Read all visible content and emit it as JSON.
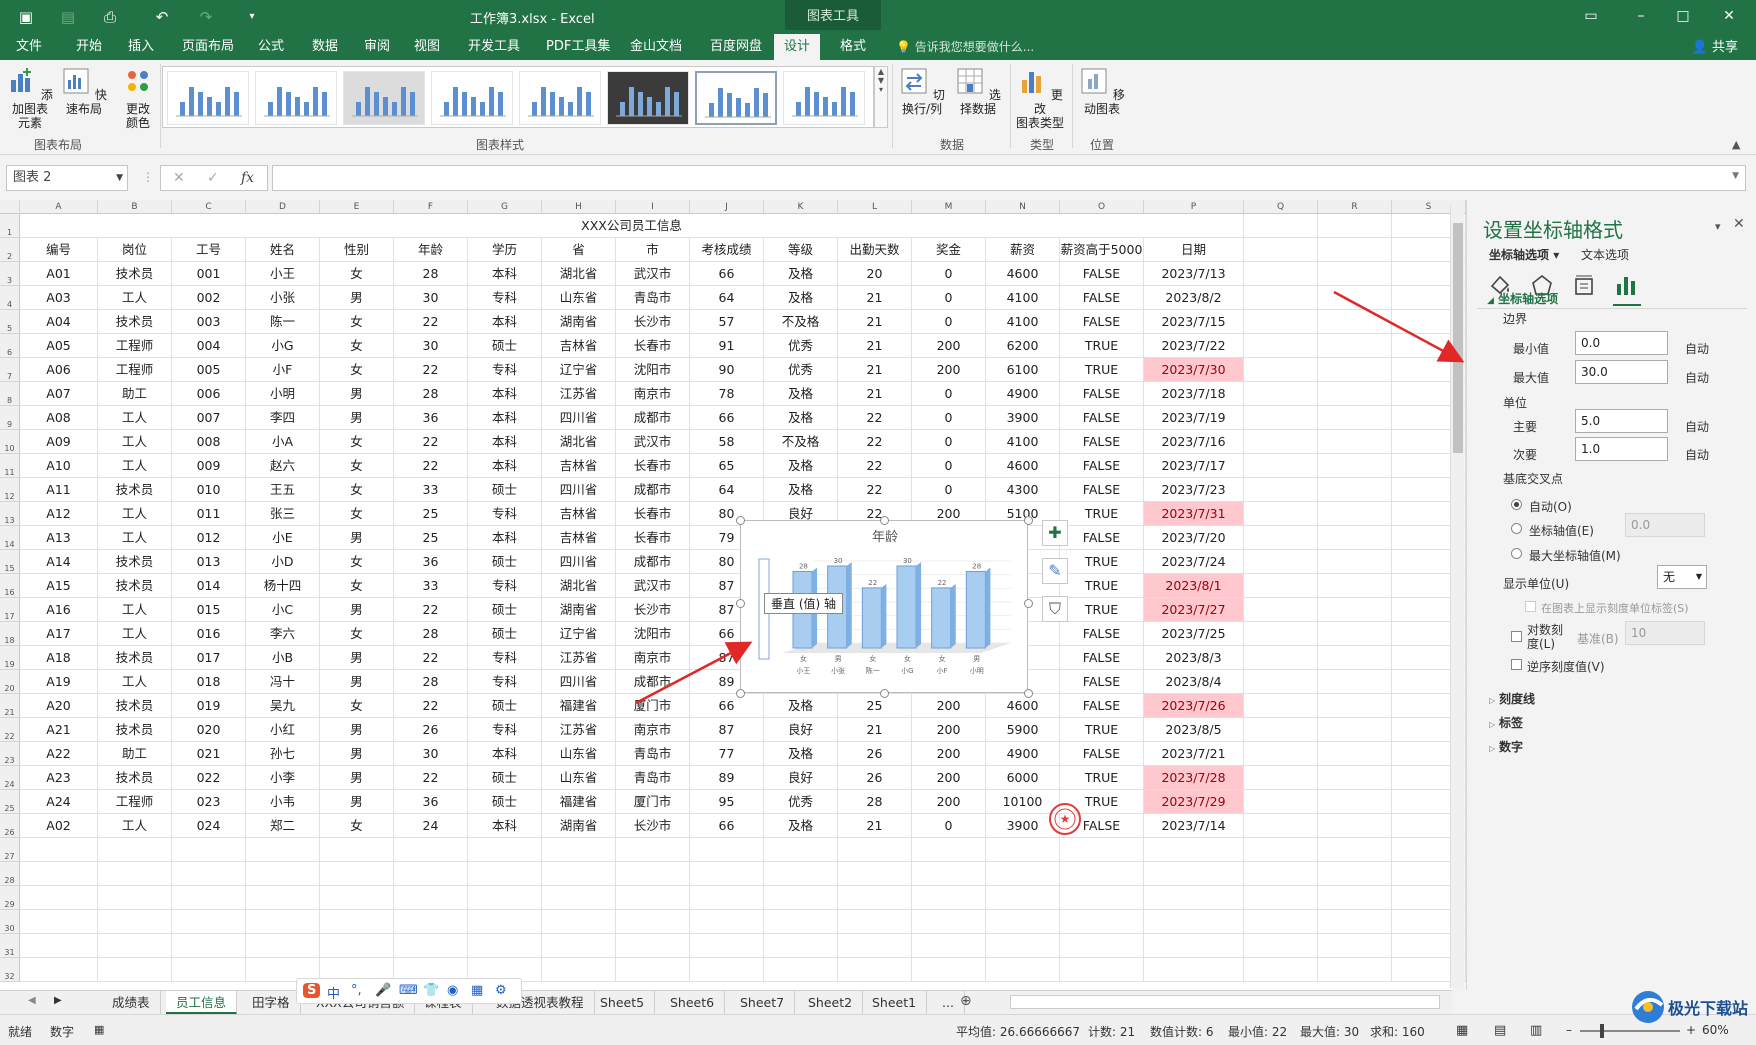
{
  "titlebar": {
    "title": "工作簿3.xlsx - Excel",
    "context_tab_title": "图表工具",
    "tell_me": "告诉我您想要做什么...",
    "share": "共享"
  },
  "ribbon_tabs": [
    "文件",
    "开始",
    "插入",
    "页面布局",
    "公式",
    "数据",
    "审阅",
    "视图",
    "开发工具",
    "PDF工具集",
    "金山文档",
    "百度网盘",
    "设计",
    "格式"
  ],
  "active_tab": "设计",
  "ribbon": {
    "add_element": "添加图表\n元素",
    "quick_layout": "快速布局",
    "change_colors": "更改\n颜色",
    "group_layout": "图表布局",
    "group_styles": "图表样式",
    "switch_row_col": "切换行/列",
    "select_data": "选择数据",
    "group_data": "数据",
    "change_type": "更改\n图表类型",
    "group_type": "类型",
    "move_chart": "移动图表",
    "group_location": "位置"
  },
  "formula_bar": {
    "name_box": "图表 2",
    "fx": "fx",
    "value": ""
  },
  "columns": [
    "A",
    "B",
    "C",
    "D",
    "E",
    "F",
    "G",
    "H",
    "I",
    "J",
    "K",
    "L",
    "M",
    "N",
    "O",
    "P",
    "Q",
    "R",
    "S"
  ],
  "sheet_title": "XXX公司员工信息",
  "table_headers": [
    "编号",
    "岗位",
    "工号",
    "姓名",
    "性别",
    "年龄",
    "学历",
    "省",
    "市",
    "考核成绩",
    "等级",
    "出勤天数",
    "奖金",
    "薪资",
    "薪资高于5000",
    "日期"
  ],
  "table_rows": [
    [
      "A01",
      "技术员",
      "001",
      "小王",
      "女",
      "28",
      "本科",
      "湖北省",
      "武汉市",
      "66",
      "及格",
      "20",
      "0",
      "4600",
      "FALSE",
      "2023/7/13"
    ],
    [
      "A03",
      "工人",
      "002",
      "小张",
      "男",
      "30",
      "专科",
      "山东省",
      "青岛市",
      "64",
      "及格",
      "21",
      "0",
      "4100",
      "FALSE",
      "2023/8/2"
    ],
    [
      "A04",
      "技术员",
      "003",
      "陈一",
      "女",
      "22",
      "本科",
      "湖南省",
      "长沙市",
      "57",
      "不及格",
      "21",
      "0",
      "4100",
      "FALSE",
      "2023/7/15"
    ],
    [
      "A05",
      "工程师",
      "004",
      "小G",
      "女",
      "30",
      "硕士",
      "吉林省",
      "长春市",
      "91",
      "优秀",
      "21",
      "200",
      "6200",
      "TRUE",
      "2023/7/22"
    ],
    [
      "A06",
      "工程师",
      "005",
      "小F",
      "女",
      "22",
      "专科",
      "辽宁省",
      "沈阳市",
      "90",
      "优秀",
      "21",
      "200",
      "6100",
      "TRUE",
      "2023/7/30"
    ],
    [
      "A07",
      "助工",
      "006",
      "小明",
      "男",
      "28",
      "本科",
      "江苏省",
      "南京市",
      "78",
      "及格",
      "21",
      "0",
      "4900",
      "FALSE",
      "2023/7/18"
    ],
    [
      "A08",
      "工人",
      "007",
      "李四",
      "男",
      "36",
      "本科",
      "四川省",
      "成都市",
      "66",
      "及格",
      "22",
      "0",
      "3900",
      "FALSE",
      "2023/7/19"
    ],
    [
      "A09",
      "工人",
      "008",
      "小A",
      "女",
      "22",
      "本科",
      "湖北省",
      "武汉市",
      "58",
      "不及格",
      "22",
      "0",
      "4100",
      "FALSE",
      "2023/7/16"
    ],
    [
      "A10",
      "工人",
      "009",
      "赵六",
      "女",
      "22",
      "本科",
      "吉林省",
      "长春市",
      "65",
      "及格",
      "22",
      "0",
      "4600",
      "FALSE",
      "2023/7/17"
    ],
    [
      "A11",
      "技术员",
      "010",
      "王五",
      "女",
      "33",
      "硕士",
      "四川省",
      "成都市",
      "64",
      "及格",
      "22",
      "0",
      "4300",
      "FALSE",
      "2023/7/23"
    ],
    [
      "A12",
      "工人",
      "011",
      "张三",
      "女",
      "25",
      "专科",
      "吉林省",
      "长春市",
      "80",
      "良好",
      "22",
      "200",
      "5100",
      "TRUE",
      "2023/7/31"
    ],
    [
      "A13",
      "工人",
      "012",
      "小E",
      "男",
      "25",
      "本科",
      "吉林省",
      "长春市",
      "79",
      "",
      "",
      "",
      "",
      "FALSE",
      "2023/7/20"
    ],
    [
      "A14",
      "技术员",
      "013",
      "小D",
      "女",
      "36",
      "硕士",
      "四川省",
      "成都市",
      "80",
      "",
      "",
      "",
      "",
      "TRUE",
      "2023/7/24"
    ],
    [
      "A15",
      "技术员",
      "014",
      "杨十四",
      "女",
      "33",
      "专科",
      "湖北省",
      "武汉市",
      "87",
      "",
      "",
      "",
      "",
      "TRUE",
      "2023/8/1"
    ],
    [
      "A16",
      "工人",
      "015",
      "小C",
      "男",
      "22",
      "硕士",
      "湖南省",
      "长沙市",
      "87",
      "",
      "",
      "",
      "",
      "TRUE",
      "2023/7/27"
    ],
    [
      "A17",
      "工人",
      "016",
      "李六",
      "女",
      "28",
      "硕士",
      "辽宁省",
      "沈阳市",
      "66",
      "",
      "",
      "",
      "",
      "FALSE",
      "2023/7/25"
    ],
    [
      "A18",
      "技术员",
      "017",
      "小B",
      "男",
      "22",
      "专科",
      "江苏省",
      "南京市",
      "87",
      "",
      "",
      "",
      "",
      "FALSE",
      "2023/8/3"
    ],
    [
      "A19",
      "工人",
      "018",
      "冯十",
      "男",
      "28",
      "专科",
      "四川省",
      "成都市",
      "89",
      "",
      "",
      "",
      "",
      "FALSE",
      "2023/8/4"
    ],
    [
      "A20",
      "技术员",
      "019",
      "吴九",
      "女",
      "22",
      "硕士",
      "福建省",
      "厦门市",
      "66",
      "及格",
      "25",
      "200",
      "4600",
      "FALSE",
      "2023/7/26"
    ],
    [
      "A21",
      "技术员",
      "020",
      "小红",
      "男",
      "26",
      "专科",
      "江苏省",
      "南京市",
      "87",
      "良好",
      "21",
      "200",
      "5900",
      "TRUE",
      "2023/8/5"
    ],
    [
      "A22",
      "助工",
      "021",
      "孙七",
      "男",
      "30",
      "本科",
      "山东省",
      "青岛市",
      "77",
      "及格",
      "26",
      "200",
      "4900",
      "FALSE",
      "2023/7/21"
    ],
    [
      "A23",
      "技术员",
      "022",
      "小李",
      "男",
      "22",
      "硕士",
      "山东省",
      "青岛市",
      "89",
      "良好",
      "26",
      "200",
      "6000",
      "TRUE",
      "2023/7/28"
    ],
    [
      "A24",
      "工程师",
      "023",
      "小韦",
      "男",
      "36",
      "硕士",
      "福建省",
      "厦门市",
      "95",
      "优秀",
      "28",
      "200",
      "10100",
      "TRUE",
      "2023/7/29"
    ],
    [
      "A02",
      "工人",
      "024",
      "郑二",
      "女",
      "24",
      "本科",
      "湖南省",
      "长沙市",
      "66",
      "及格",
      "21",
      "0",
      "3900",
      "FALSE",
      "2023/7/14"
    ]
  ],
  "highlighted_dates": [
    "2023/7/30",
    "2023/7/31",
    "2023/8/1",
    "2023/7/27",
    "2023/7/26",
    "2023/7/28",
    "2023/7/29"
  ],
  "chart_data": {
    "type": "bar",
    "title": "年龄",
    "categories": [
      "小王",
      "小张",
      "陈一",
      "小G",
      "小F",
      "小明"
    ],
    "category_gender": [
      "女",
      "男",
      "女",
      "女",
      "女",
      "男"
    ],
    "values": [
      28,
      30,
      22,
      30,
      22,
      28
    ],
    "ylim": [
      0,
      30
    ],
    "grid": true,
    "legend": "none",
    "bar_color": "#a8cdf0"
  },
  "chart_tooltip": "垂直 (值) 轴",
  "format_pane": {
    "title": "设置坐标轴格式",
    "tab_axis": "坐标轴选项",
    "tab_text": "文本选项",
    "section": "坐标轴选项",
    "bounds": "边界",
    "min_label": "最小值",
    "min_value": "0.0",
    "max_label": "最大值",
    "max_value": "30.0",
    "auto": "自动",
    "units": "单位",
    "major_label": "主要",
    "major_value": "5.0",
    "minor_label": "次要",
    "minor_value": "1.0",
    "cross_label": "基底交叉点",
    "cross_auto": "自动(O)",
    "cross_value": "坐标轴值(E)",
    "cross_value_input": "0.0",
    "cross_max": "最大坐标轴值(M)",
    "display_units": "显示单位(U)",
    "display_units_value": "无",
    "show_units_label": "在图表上显示刻度单位标签(S)",
    "log_scale": "对数刻度(L)",
    "log_base_label": "基准(B)",
    "log_base_value": "10",
    "reverse": "逆序刻度值(V)",
    "tick_marks": "刻度线",
    "labels": "标签",
    "number": "数字"
  },
  "sheet_tabs": [
    "成绩表",
    "员工信息",
    "田字格",
    "XXX公司销售额",
    "课程表",
    "数据透视表教程",
    "Sheet5",
    "Sheet6",
    "Sheet7",
    "Sheet2",
    "Sheet1",
    "..."
  ],
  "active_sheet": "员工信息",
  "status": {
    "ready": "就绪",
    "mode": "数字",
    "average": "平均值: 26.66666667",
    "count": "计数: 21",
    "num_count": "数值计数: 6",
    "min": "最小值: 22",
    "max": "最大值: 30",
    "sum": "求和: 160",
    "zoom": "60%"
  },
  "ime_icons": [
    "S",
    "中",
    "°,",
    "mic",
    "keyboard",
    "shirt",
    "gamepad",
    "grid",
    "gear"
  ],
  "watermark": "极光下载站"
}
